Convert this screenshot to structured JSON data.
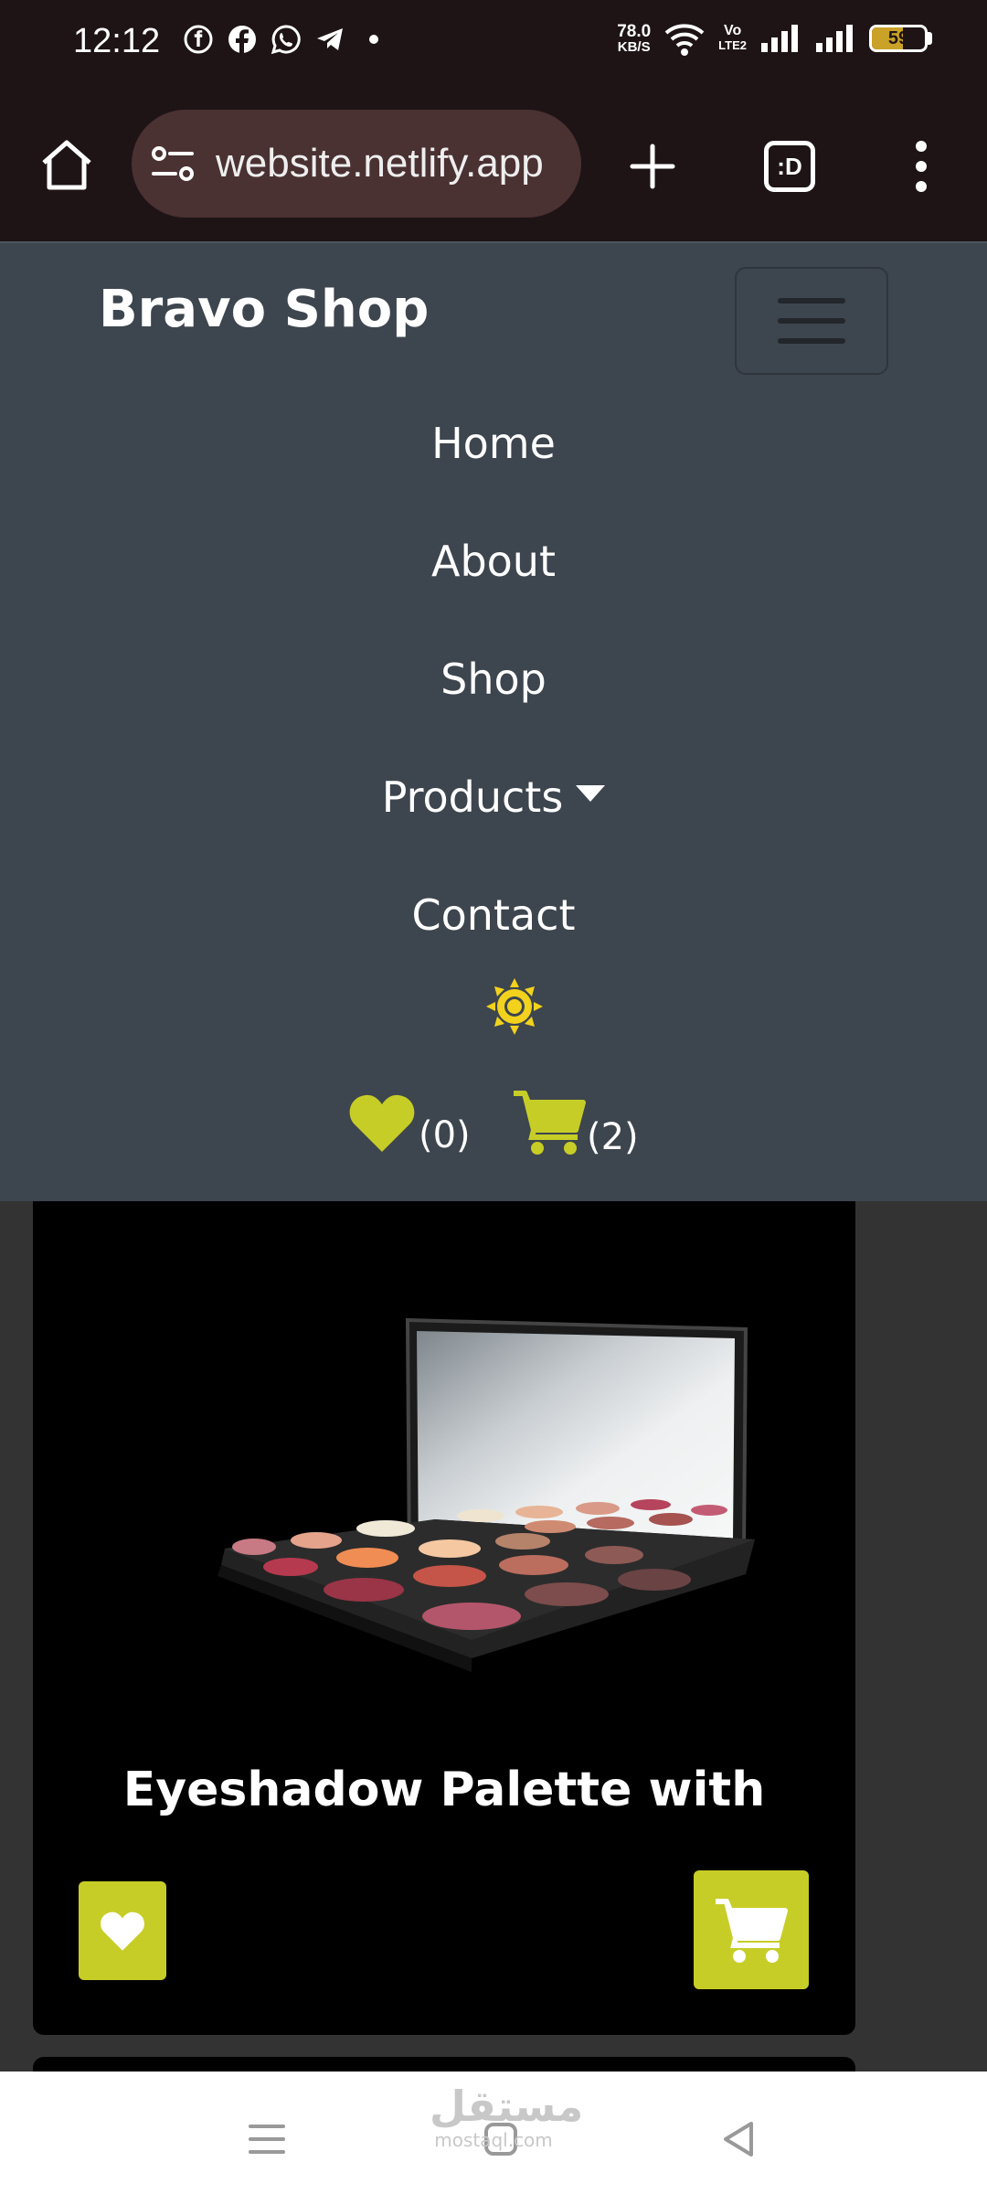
{
  "status_bar": {
    "time": "12:12",
    "app_icons": [
      "facebook-lite-icon",
      "facebook-icon",
      "whatsapp-icon",
      "telegram-icon",
      "dot-icon"
    ],
    "net_speed_value": "78.0",
    "net_speed_unit": "KB/S",
    "volte_line1": "Vo",
    "volte_line2": "LTE2",
    "battery": "59",
    "battery_level": 0.59
  },
  "browser": {
    "url": "website.netlify.app",
    "tabs_label": ":D"
  },
  "navbar": {
    "brand": "Bravo Shop",
    "links": [
      {
        "label": "Home"
      },
      {
        "label": "About"
      },
      {
        "label": "Shop"
      },
      {
        "label": "Products"
      },
      {
        "label": "Contact"
      }
    ],
    "wishlist_count": "(0)",
    "cart_count": "(2)",
    "accent_color": "#c7cd27"
  },
  "product": {
    "title": "Eyeshadow Palette with"
  },
  "watermark": {
    "arabic": "مستقل",
    "latin": "mostaql.com"
  }
}
